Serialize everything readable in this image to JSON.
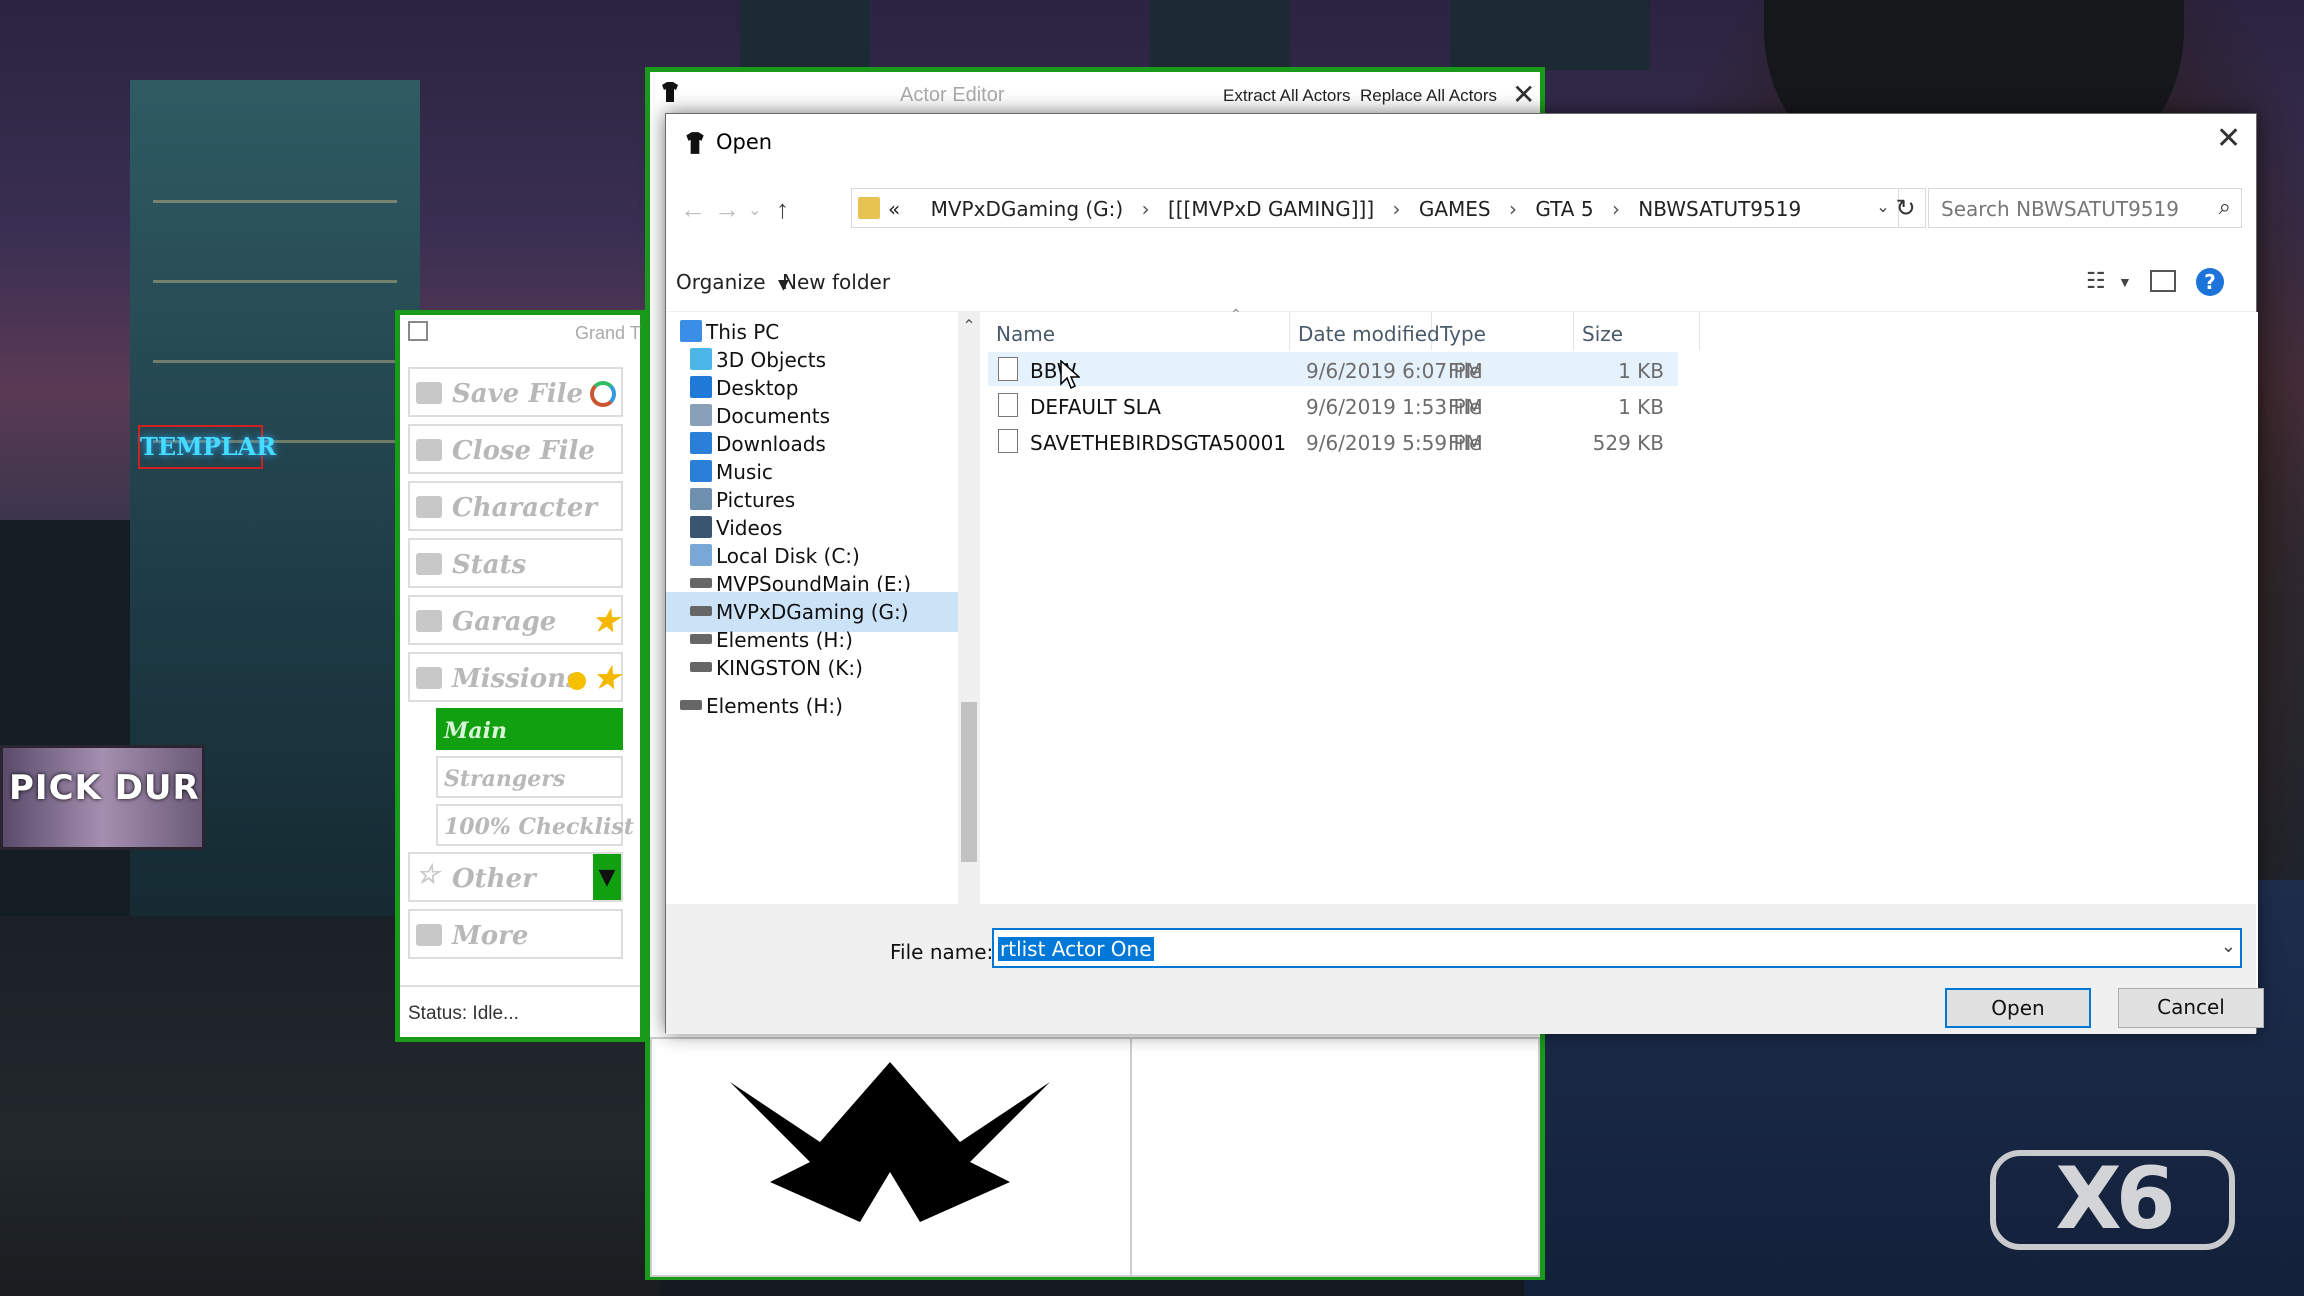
{
  "gta_window": {
    "title": "Grand T",
    "buttons": [
      {
        "label": "Save File"
      },
      {
        "label": "Close File"
      },
      {
        "label": "Character"
      },
      {
        "label": "Stats"
      },
      {
        "label": "Garage"
      },
      {
        "label": "Missions"
      }
    ],
    "mission_subs": [
      {
        "label": "Main",
        "active": true
      },
      {
        "label": "Strangers"
      },
      {
        "label": "100% Checklist"
      }
    ],
    "buttons_after": [
      {
        "label": "Other"
      },
      {
        "label": "More"
      }
    ],
    "status": "Status: Idle..."
  },
  "actor_editor": {
    "title": "Actor Editor",
    "extract_all": "Extract All Actors",
    "replace_all": "Replace All Actors"
  },
  "open_dialog": {
    "title": "Open",
    "address": {
      "prefix": "«",
      "crumbs": [
        "MVPxDGaming (G:)",
        "[[[MVPxD GAMING]]]",
        "GAMES",
        "GTA 5",
        "NBWSATUT9519"
      ]
    },
    "search_placeholder": "Search NBWSATUT9519",
    "toolbar": {
      "organize": "Organize",
      "new_folder": "New folder"
    },
    "nav_items": [
      {
        "label": "This PC",
        "icon": "pc-icon",
        "color": "#3a8ee6"
      },
      {
        "label": "3D Objects",
        "icon": "cube-icon",
        "color": "#4db6e8"
      },
      {
        "label": "Desktop",
        "icon": "desktop-icon",
        "color": "#1f79d6"
      },
      {
        "label": "Documents",
        "icon": "documents-icon",
        "color": "#8aa0b8"
      },
      {
        "label": "Downloads",
        "icon": "download-icon",
        "color": "#2a7fd9"
      },
      {
        "label": "Music",
        "icon": "music-icon",
        "color": "#2a7fd9"
      },
      {
        "label": "Pictures",
        "icon": "pictures-icon",
        "color": "#6f8fae"
      },
      {
        "label": "Videos",
        "icon": "videos-icon",
        "color": "#39556f"
      },
      {
        "label": "Local Disk (C:)",
        "icon": "windows-drive-icon",
        "color": "#7aa8d6"
      },
      {
        "label": "MVPSoundMain (E:)",
        "icon": "drive-icon",
        "color": "#666666"
      },
      {
        "label": "MVPxDGaming (G:)",
        "icon": "drive-icon",
        "color": "#666666",
        "selected": true
      },
      {
        "label": "Elements (H:)",
        "icon": "drive-icon",
        "color": "#666666"
      },
      {
        "label": "KINGSTON (K:)",
        "icon": "drive-icon",
        "color": "#666666"
      },
      {
        "label": "Elements (H:)",
        "icon": "drive-icon",
        "color": "#666666"
      }
    ],
    "columns": {
      "name": "Name",
      "date": "Date modified",
      "type": "Type",
      "size": "Size"
    },
    "files": [
      {
        "name": "BBW",
        "date": "9/6/2019 6:07 PM",
        "type": "File",
        "size": "1 KB",
        "hover": true
      },
      {
        "name": "DEFAULT SLA",
        "date": "9/6/2019 1:53 PM",
        "type": "File",
        "size": "1 KB"
      },
      {
        "name": "SAVETHEBIRDSGTA50001",
        "date": "9/6/2019 5:59 PM",
        "type": "File",
        "size": "529 KB"
      }
    ],
    "file_name_label": "File name:",
    "file_name_value": "rtlist Actor One",
    "open_button": "Open",
    "cancel_button": "Cancel"
  },
  "colors": {
    "accent_green": "#1a9a1a",
    "selection_blue": "#0078d7",
    "nav_selected": "#cce2f7",
    "help_blue": "#1c73d9"
  }
}
